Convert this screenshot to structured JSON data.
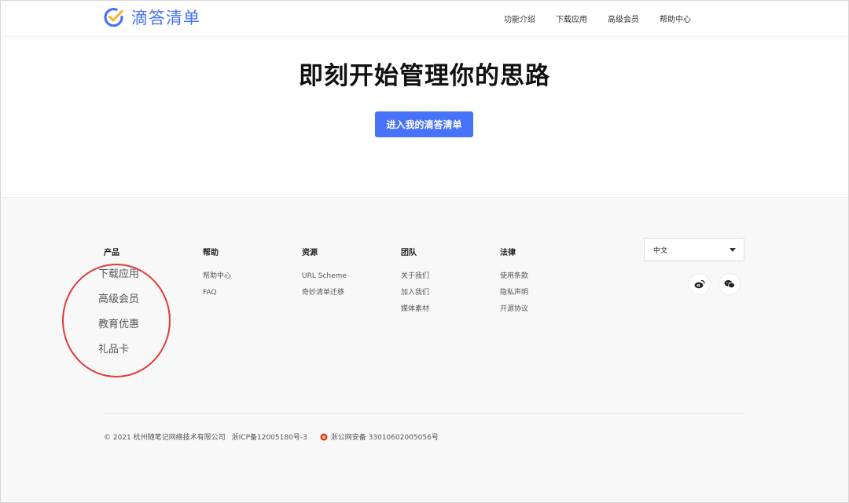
{
  "header": {
    "logo_text": "滴答清单",
    "nav": [
      "功能介绍",
      "下载应用",
      "高级会员",
      "帮助中心"
    ]
  },
  "hero": {
    "title": "即刻开始管理你的思路",
    "cta": "进入我的滴答清单"
  },
  "footer": {
    "columns": [
      {
        "title": "产品",
        "links": [
          "下载应用",
          "高级会员",
          "教育优惠",
          "礼品卡"
        ]
      },
      {
        "title": "帮助",
        "links": [
          "帮助中心",
          "FAQ"
        ]
      },
      {
        "title": "资源",
        "links": [
          "URL Scheme",
          "奇妙清单迁移"
        ]
      },
      {
        "title": "团队",
        "links": [
          "关于我们",
          "加入我们",
          "媒体素材"
        ]
      },
      {
        "title": "法律",
        "links": [
          "使用条款",
          "隐私声明",
          "开源协议"
        ]
      }
    ],
    "language": "中文",
    "social": [
      "weibo-icon",
      "wechat-icon"
    ],
    "copyright": "© 2021 杭州随笔记网络技术有限公司",
    "icp": "浙ICP备12005180号-3",
    "police": "浙公网安备 33010602005056号"
  },
  "colors": {
    "brand": "#4772fa",
    "annotation": "#e03a3a"
  }
}
